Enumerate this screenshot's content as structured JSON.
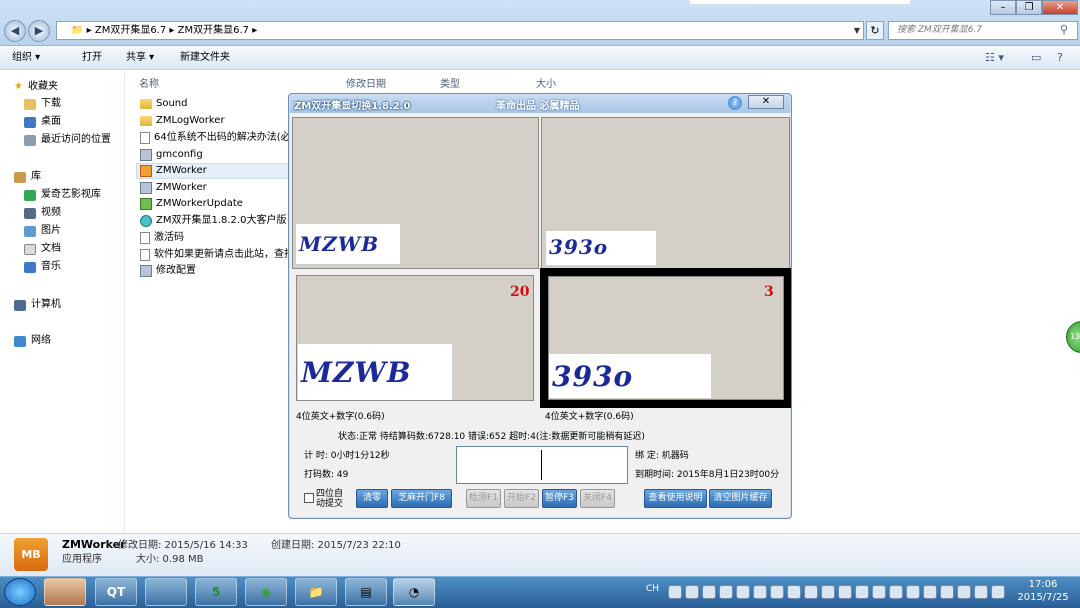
{
  "explorer": {
    "breadcrumb": [
      "ZM双开集显6.7",
      "ZM双开集显6.7"
    ],
    "search_placeholder": "搜索 ZM双开集显6.7",
    "toolbar": [
      "组织 ▾",
      "打开",
      "共享 ▾",
      "新建文件夹"
    ],
    "sidebar": {
      "favorites": "收藏夹",
      "fav_items": [
        "下载",
        "桌面",
        "最近访问的位置"
      ],
      "library": "库",
      "lib_items": [
        "爱奇艺影视库",
        "视频",
        "图片",
        "文档",
        "音乐"
      ],
      "computer": "计算机",
      "network": "网络"
    },
    "columns": [
      "名称",
      "修改日期",
      "类型",
      "大小"
    ],
    "files": [
      "Sound",
      "ZMLogWorker",
      "64位系统不出码的解决办法(必读",
      "gmconfig",
      "ZMWorker",
      "ZMWorker",
      "ZMWorkerUpdate",
      "ZM双开集显1.8.2.0大客户版",
      "激活码",
      "软件如果更新请点击此站，查找",
      "修改配置"
    ],
    "details": {
      "name": "ZMWorker",
      "modified": "修改日期: 2015/5/16 14:33",
      "created": "创建日期: 2015/7/23 22:10",
      "type": "应用程序",
      "size": "大小: 0.98 MB",
      "icon_text": "MB"
    }
  },
  "dialog": {
    "title": "ZM双开集显切换1.8.2.0",
    "subtitle": "革命出品 必属精品",
    "close": "✕",
    "captcha_left": "MZWB",
    "captcha_right": "393o",
    "count_left": "20",
    "count_right": "3",
    "type_left": "4位英文+数字(0.6码)",
    "type_right": "4位英文+数字(0.6码)",
    "status": "状态:正常 待结算码数:6728.10 错误:652 超时:4(注:数据更新可能稍有延迟)",
    "timer": "计  时: 0小时1分12秒",
    "codes": "打码数: 49",
    "binding": "绑    定: 机器码",
    "expiry": "到期时间: 2015年8月1日23时00分",
    "checkbox_label_1": "四位自",
    "checkbox_label_2": "动提交",
    "buttons": [
      "清零",
      "芝麻开门F8",
      "检测F1",
      "开始F2",
      "暂停F3",
      "关闭F4",
      "查看使用说明",
      "清空图片缓存"
    ]
  },
  "taskbar": {
    "lang": "CH",
    "time": "17:06",
    "date": "2015/7/25",
    "apps": [
      "QT",
      "5"
    ]
  },
  "side_orb": "13"
}
